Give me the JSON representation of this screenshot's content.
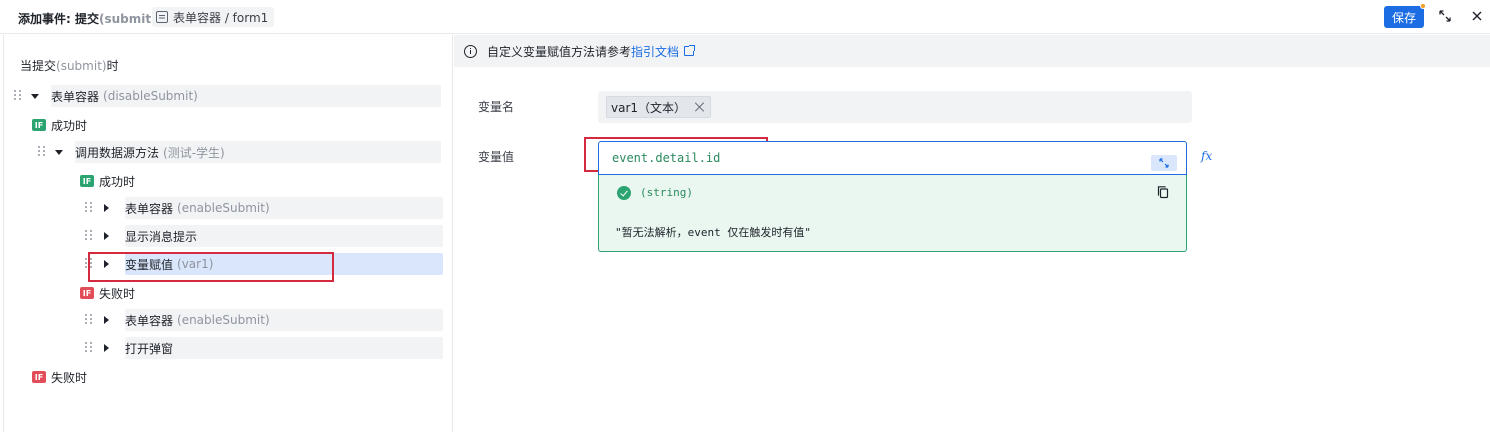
{
  "header": {
    "title_prefix": "添加事件: 提交",
    "title_event": "(submit)",
    "target_tag": "表单容器 / form1",
    "save_label": "保存"
  },
  "tree": {
    "when_prefix": "当提交",
    "when_event": "(submit)",
    "when_suffix": "时",
    "root": {
      "label": "表单容器",
      "detail": "(disableSubmit)"
    },
    "success_label": "成功时",
    "fail_label": "失败时",
    "api_call": {
      "label": "调用数据源方法",
      "detail": "(测试-学生)"
    },
    "inner_success_label": "成功时",
    "inner_fail_label": "失败时",
    "if_badge": "IF",
    "success_actions": [
      {
        "label": "表单容器",
        "detail": "(enableSubmit)"
      },
      {
        "label": "显示消息提示",
        "detail": ""
      },
      {
        "label": "变量赋值",
        "detail": "(var1)"
      }
    ],
    "fail_actions": [
      {
        "label": "表单容器",
        "detail": "(enableSubmit)"
      },
      {
        "label": "打开弹窗",
        "detail": ""
      }
    ]
  },
  "config": {
    "tip_text": "自定义变量赋值方法请参考",
    "tip_link": "指引文档",
    "var_name_label": "变量名",
    "var_name_chip": "var1（文本）",
    "var_value_label": "变量值",
    "var_value_expr": "event.detail.id",
    "fx_label": "fx",
    "result_type": "(string)",
    "result_message": "\"暂无法解析，event 仅在触发时有值\""
  },
  "colors": {
    "primary": "#1c6de3",
    "success": "#2ba471",
    "danger": "#e34d59",
    "highlight": "#d42a3f",
    "selected_bg": "#d9e6fb"
  }
}
